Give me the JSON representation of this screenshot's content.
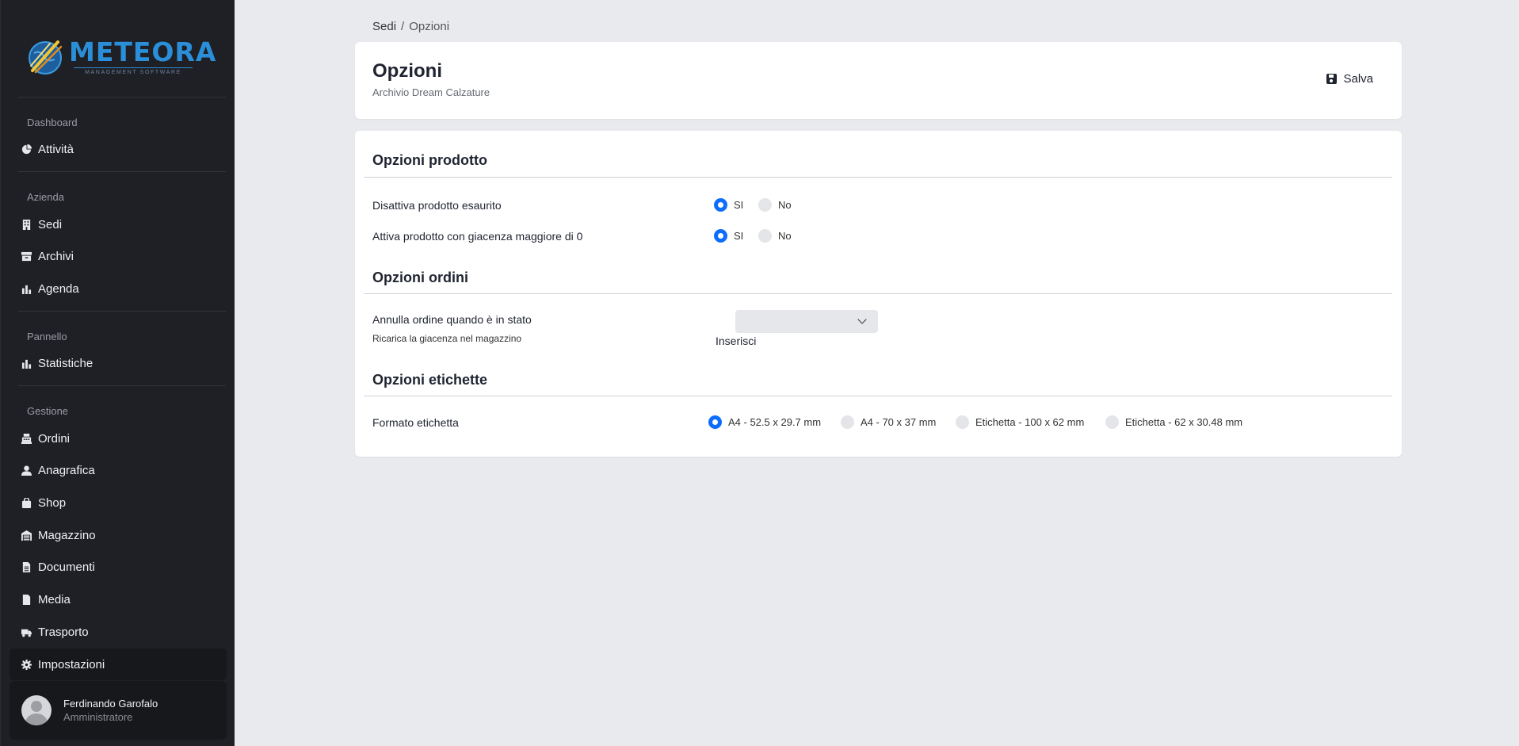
{
  "logo": {
    "word": "METEORA",
    "tagline": "MANAGEMENT SOFTWARE"
  },
  "sidebar": {
    "sections": [
      {
        "label": "Dashboard",
        "items": [
          {
            "label": "Attività",
            "icon": "pie-chart-icon"
          }
        ]
      },
      {
        "label": "Azienda",
        "items": [
          {
            "label": "Sedi",
            "icon": "building-icon"
          },
          {
            "label": "Archivi",
            "icon": "archive-icon"
          },
          {
            "label": "Agenda",
            "icon": "bar-chart-icon"
          }
        ]
      },
      {
        "label": "Pannello",
        "items": [
          {
            "label": "Statistiche",
            "icon": "bar-chart-icon"
          }
        ]
      },
      {
        "label": "Gestione",
        "items": [
          {
            "label": "Ordini",
            "icon": "cash-register-icon"
          },
          {
            "label": "Anagrafica",
            "icon": "user-icon"
          },
          {
            "label": "Shop",
            "icon": "shopping-bag-icon"
          },
          {
            "label": "Magazzino",
            "icon": "warehouse-icon"
          },
          {
            "label": "Documenti",
            "icon": "document-icon"
          },
          {
            "label": "Media",
            "icon": "file-icon"
          },
          {
            "label": "Trasporto",
            "icon": "truck-icon"
          },
          {
            "label": "Impostazioni",
            "icon": "gear-icon",
            "active": true
          }
        ]
      }
    ]
  },
  "user": {
    "name": "Ferdinando Garofalo",
    "role": "Amministratore"
  },
  "breadcrumb": {
    "parent": "Sedi",
    "separator": "/",
    "current": "Opzioni"
  },
  "header": {
    "title": "Opzioni",
    "subtitle": "Archivio Dream Calzature",
    "save_label": "Salva"
  },
  "sections": {
    "product": {
      "title": "Opzioni prodotto",
      "options": [
        {
          "label": "Disattiva prodotto esaurito",
          "yes": "SI",
          "no": "No",
          "selected": "SI"
        },
        {
          "label": "Attiva prodotto con giacenza maggiore di 0",
          "yes": "SI",
          "no": "No",
          "selected": "SI"
        }
      ]
    },
    "orders": {
      "title": "Opzioni ordini",
      "cancel_label": "Annulla ordine quando è in stato",
      "cancel_help": "Ricarica la giacenza nel magazzino",
      "select_value": "",
      "insert_label": "Inserisci"
    },
    "labels": {
      "title": "Opzioni etichette",
      "format_label": "Formato etichetta",
      "formats": [
        "A4 - 52.5 x 29.7 mm",
        "A4 - 70 x 37 mm",
        "Etichetta - 100 x 62 mm",
        "Etichetta - 62 x 30.48 mm"
      ],
      "selected": "A4 - 52.5 x 29.7 mm"
    }
  },
  "colors": {
    "accent": "#0d6efd",
    "sidebar_bg": "#1f2025",
    "page_bg": "#e9eaee",
    "logo_blue": "#2a8fd8"
  }
}
